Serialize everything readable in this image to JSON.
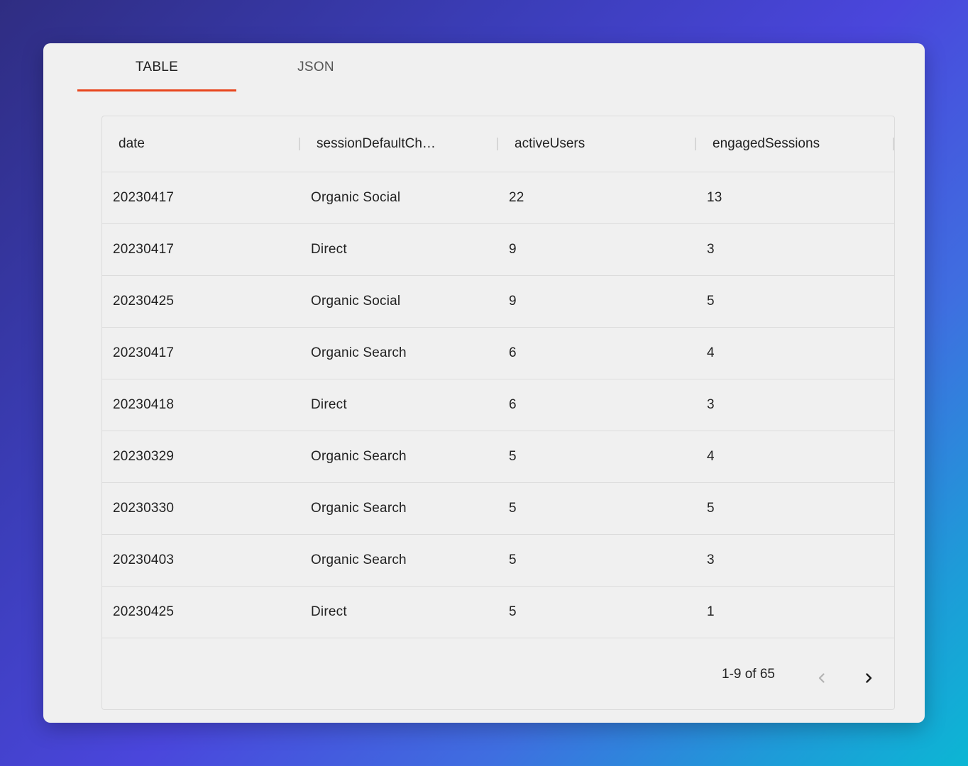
{
  "tabs": [
    {
      "label": "TABLE",
      "active": true
    },
    {
      "label": "JSON",
      "active": false
    }
  ],
  "table": {
    "columns": [
      "date",
      "sessionDefaultCh…",
      "activeUsers",
      "engagedSessions"
    ],
    "rows": [
      [
        "20230417",
        "Organic Social",
        "22",
        "13"
      ],
      [
        "20230417",
        "Direct",
        "9",
        "3"
      ],
      [
        "20230425",
        "Organic Social",
        "9",
        "5"
      ],
      [
        "20230417",
        "Organic Search",
        "6",
        "4"
      ],
      [
        "20230418",
        "Direct",
        "6",
        "3"
      ],
      [
        "20230329",
        "Organic Search",
        "5",
        "4"
      ],
      [
        "20230330",
        "Organic Search",
        "5",
        "5"
      ],
      [
        "20230403",
        "Organic Search",
        "5",
        "3"
      ],
      [
        "20230425",
        "Direct",
        "5",
        "1"
      ]
    ]
  },
  "pagination": {
    "label": "1-9 of 65",
    "prev_icon": "chevron-left-icon",
    "next_icon": "chevron-right-icon",
    "prev_enabled": false,
    "next_enabled": true
  },
  "colors": {
    "tab_indicator": "#e8461e",
    "card_background": "#f0f0f0"
  }
}
